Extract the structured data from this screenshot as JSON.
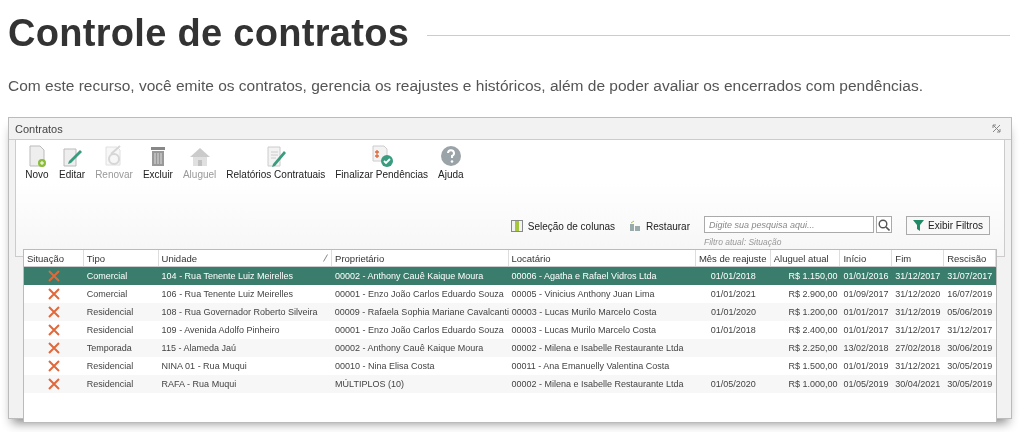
{
  "page": {
    "title": "Controle de contratos",
    "description": "Com este recurso, você emite os contratos, gerencia os reajustes e históricos, além de poder avaliar os encerrados com pendências."
  },
  "window": {
    "title": "Contratos"
  },
  "toolbar": [
    {
      "label": "Novo",
      "disabled": false
    },
    {
      "label": "Editar",
      "disabled": false
    },
    {
      "label": "Renovar",
      "disabled": true
    },
    {
      "label": "Excluir",
      "disabled": false
    },
    {
      "label": "Aluguel",
      "disabled": true
    },
    {
      "label": "Relatórios Contratuais",
      "disabled": false
    },
    {
      "label": "Finalizar Pendências",
      "disabled": false
    },
    {
      "label": "Ajuda",
      "disabled": false
    }
  ],
  "column_selection": "Seleção de colunas",
  "restore": "Restaurar",
  "search": {
    "placeholder": "Digite sua pesquisa aqui..."
  },
  "filter_button": "Exibir Filtros",
  "current_filter": "Filtro atual: Situação",
  "table": {
    "columns": [
      "Situação",
      "Tipo",
      "Unidade",
      "Proprietário",
      "Locatário",
      "Mês de reajuste",
      "Aluguel atual",
      "Início",
      "Fim",
      "Rescisão"
    ],
    "rows": [
      {
        "selected": true,
        "cells": [
          "",
          "Comercial",
          "104 - Rua Tenente Luiz Meirelles",
          "00002 - Anthony Cauê Kaique Moura",
          "00006 - Agatha e Rafael Vidros Ltda",
          "01/01/2018",
          "R$ 1.150,00",
          "01/01/2016",
          "31/12/2017",
          "31/07/2017"
        ]
      },
      {
        "selected": false,
        "cells": [
          "",
          "Comercial",
          "106 - Rua Tenente Luiz Meirelles",
          "00001 - Enzo João Carlos Eduardo Souza",
          "00005 - Vinicius Anthony Juan Lima",
          "01/01/2021",
          "R$ 2.900,00",
          "01/09/2017",
          "31/12/2020",
          "16/07/2019"
        ]
      },
      {
        "selected": false,
        "cells": [
          "",
          "Residencial",
          "108 - Rua Governador Roberto Silveira",
          "00009 - Rafaela Sophia Mariane Cavalcanti",
          "00003 - Lucas Murilo Marcelo Costa",
          "01/01/2020",
          "R$ 1.200,00",
          "01/01/2017",
          "31/12/2019",
          "05/06/2019"
        ]
      },
      {
        "selected": false,
        "cells": [
          "",
          "Residencial",
          "109 - Avenida Adolfo Pinheiro",
          "00001 - Enzo João Carlos Eduardo Souza",
          "00003 - Lucas Murilo Marcelo Costa",
          "01/01/2018",
          "R$ 2.400,00",
          "01/01/2017",
          "31/12/2017",
          "31/12/2017"
        ]
      },
      {
        "selected": false,
        "cells": [
          "",
          "Temporada",
          "115 - Alameda Jaú",
          "00002 - Anthony Cauê Kaique Moura",
          "00002 - Milena e Isabelle Restaurante Ltda",
          "",
          "R$ 2.250,00",
          "13/02/2018",
          "27/02/2018",
          "30/06/2019"
        ]
      },
      {
        "selected": false,
        "cells": [
          "",
          "Residencial",
          "NINA 01 - Rua Muqui",
          "00010 - Nina Elisa Costa",
          "00011 - Ana Emanuelly Valentina Costa",
          "",
          "R$ 1.500,00",
          "01/01/2019",
          "31/12/2021",
          "30/05/2019"
        ]
      },
      {
        "selected": false,
        "cells": [
          "",
          "Residencial",
          "RAFA - Rua Muqui",
          "MÚLTIPLOS (10)",
          "00002 - Milena e Isabelle Restaurante Ltda",
          "01/05/2020",
          "R$ 1.000,00",
          "01/05/2019",
          "30/04/2021",
          "30/05/2019"
        ]
      }
    ]
  }
}
